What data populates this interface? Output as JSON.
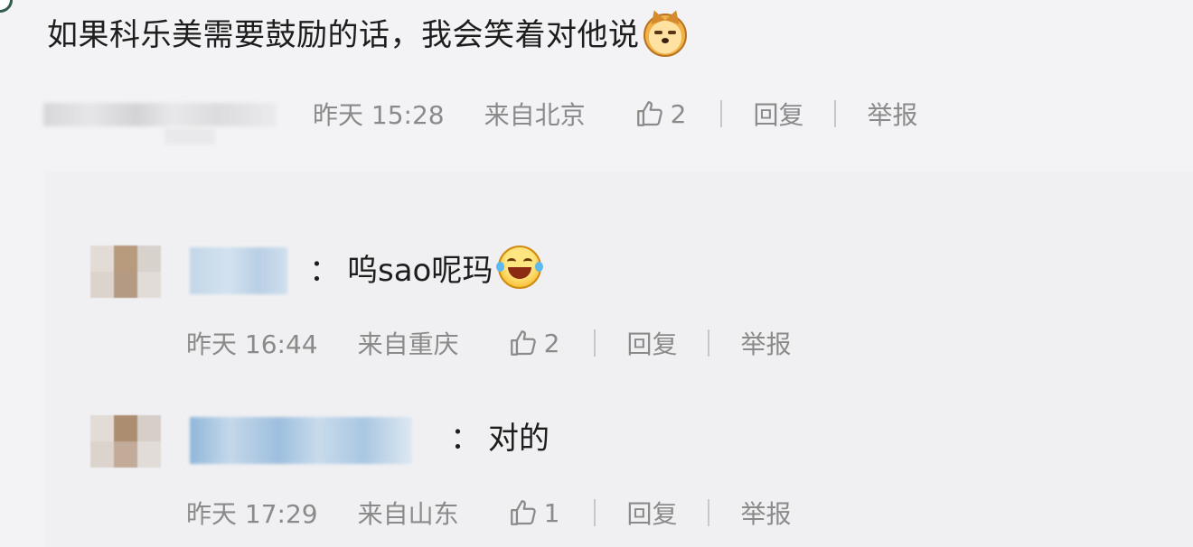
{
  "main_comment": {
    "text": "如果科乐美需要鼓励的话，我会笑着对他说",
    "emoji": "doge-emoji",
    "time": "昨天 15:28",
    "location": "来自北京",
    "likes": "2",
    "reply_label": "回复",
    "report_label": "举报"
  },
  "replies": [
    {
      "separator": "：",
      "text": "呜sao呢玛",
      "emoji": "laughing-tears-emoji",
      "time": "昨天 16:44",
      "location": "来自重庆",
      "likes": "2",
      "reply_label": "回复",
      "report_label": "举报"
    },
    {
      "separator": "：",
      "text": "对的",
      "time": "昨天 17:29",
      "location": "来自山东",
      "likes": "1",
      "reply_label": "回复",
      "report_label": "举报"
    }
  ],
  "icons": {
    "like": "thumbs-up-icon"
  },
  "colors": {
    "meta_text": "#8a8a8a",
    "background": "#f3f3f5",
    "reply_background": "#f0f0f2"
  }
}
